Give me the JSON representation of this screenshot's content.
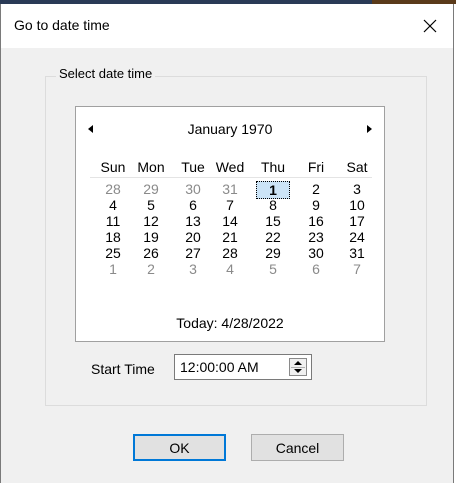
{
  "window": {
    "title": "Go to date time",
    "close_icon": "close-icon"
  },
  "group": {
    "label": "Select date time"
  },
  "calendar": {
    "month_label": "January 1970",
    "prev_icon": "triangle-left-icon",
    "next_icon": "triangle-right-icon",
    "weekdays": [
      "Sun",
      "Mon",
      "Tue",
      "Wed",
      "Thu",
      "Fri",
      "Sat"
    ],
    "weeks": [
      [
        "28",
        "29",
        "30",
        "31",
        "1",
        "2",
        "3"
      ],
      [
        "4",
        "5",
        "6",
        "7",
        "8",
        "9",
        "10"
      ],
      [
        "11",
        "12",
        "13",
        "14",
        "15",
        "16",
        "17"
      ],
      [
        "18",
        "19",
        "20",
        "21",
        "22",
        "23",
        "24"
      ],
      [
        "25",
        "26",
        "27",
        "28",
        "29",
        "30",
        "31"
      ],
      [
        "1",
        "2",
        "3",
        "4",
        "5",
        "6",
        "7"
      ]
    ],
    "out_of_month": [
      [
        true,
        true,
        true,
        true,
        false,
        false,
        false
      ],
      [
        false,
        false,
        false,
        false,
        false,
        false,
        false
      ],
      [
        false,
        false,
        false,
        false,
        false,
        false,
        false
      ],
      [
        false,
        false,
        false,
        false,
        false,
        false,
        false
      ],
      [
        false,
        false,
        false,
        false,
        false,
        false,
        false
      ],
      [
        true,
        true,
        true,
        true,
        true,
        true,
        true
      ]
    ],
    "selected_day": "1",
    "today_label": "Today: 4/28/2022"
  },
  "start_time": {
    "label": "Start Time",
    "value": "12:00:00 AM",
    "spin_icon": "spin-updown-icon"
  },
  "buttons": {
    "ok": "OK",
    "cancel": "Cancel"
  },
  "colors": {
    "selected_fill": "#cce4f7",
    "default_button_border": "#0078d7",
    "dialog_bg": "#f0f0f0"
  }
}
